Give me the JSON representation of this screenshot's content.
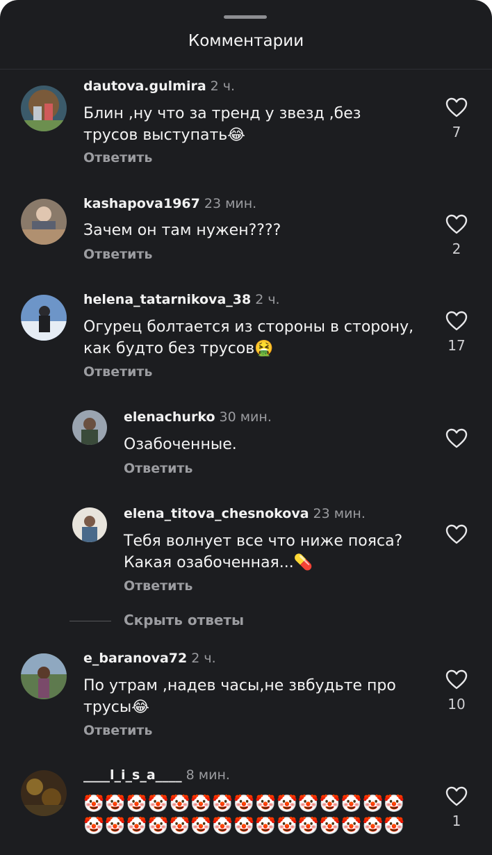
{
  "sheet": {
    "title": "Комментарии"
  },
  "comments": [
    {
      "user": "dautova.gulmira",
      "time": "2 ч.",
      "text": "Блин ,ну что за тренд у звезд ,без\nтрусов выступать😂",
      "reply": "Ответить",
      "likes": "7"
    },
    {
      "user": "kashapova1967",
      "time": "23 мин.",
      "text": "Зачем он там нужен????",
      "reply": "Ответить",
      "likes": "2"
    },
    {
      "user": "helena_tatarnikova_38",
      "time": "2 ч.",
      "text": "Огурец болтается из стороны в сторону,\nкак будто без трусов🤮",
      "reply": "Ответить",
      "likes": "17"
    },
    {
      "user": "elenachurko",
      "time": "30 мин.",
      "text": "Озабоченные.",
      "reply": "Ответить",
      "likes": ""
    },
    {
      "user": "elena_titova_chesnokova",
      "time": "23 мин.",
      "text": "Тебя волнует все что ниже пояса?\nКакая озабоченная...💊",
      "reply": "Ответить",
      "likes": ""
    },
    {
      "user": "e_baranova72",
      "time": "2 ч.",
      "text": "По утрам ,надев часы,не звбудьте про\nтрусы😂",
      "reply": "Ответить",
      "likes": "10"
    },
    {
      "user": "____l_i_s_a____",
      "time": "8 мин.",
      "text": "🤡🤡🤡🤡🤡🤡🤡🤡🤡🤡🤡🤡🤡🤡🤡🤡🤡🤡🤡🤡🤡🤡🤡🤡🤡🤡🤡🤡🤡🤡",
      "reply": "",
      "likes": "1"
    }
  ],
  "hide_replies": "Скрыть ответы",
  "icons": {
    "like": "heart-outline-icon"
  },
  "colors": {
    "background": "#1c1d20",
    "muted": "#9c9da1"
  }
}
